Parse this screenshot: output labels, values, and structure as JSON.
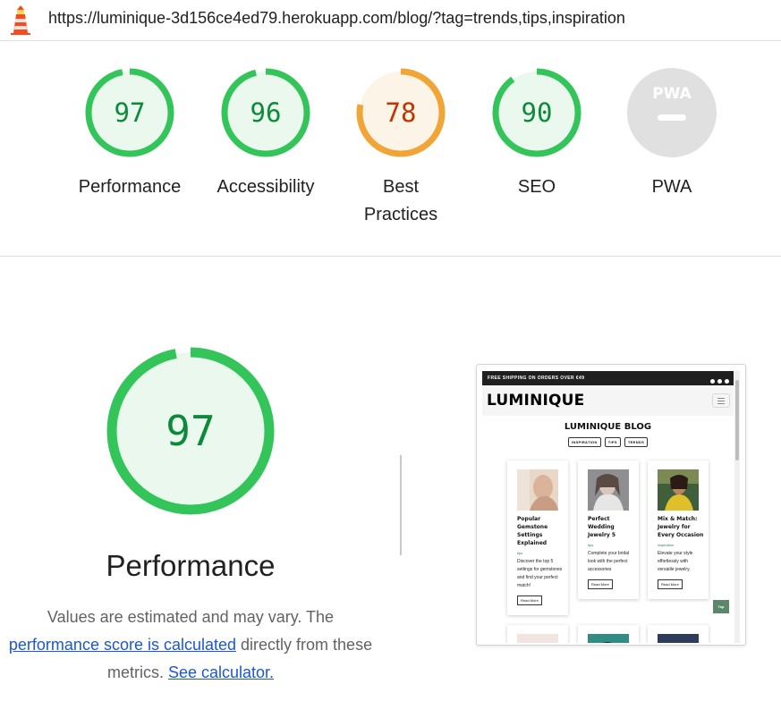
{
  "address_bar": {
    "url": "https://luminique-3d156ce4ed79.herokuapp.com/blog/?tag=trends,tips,inspiration"
  },
  "gauges": [
    {
      "label": "Performance",
      "score": "97",
      "value": 97,
      "status": "pass"
    },
    {
      "label": "Accessibility",
      "score": "96",
      "value": 96,
      "status": "pass"
    },
    {
      "label": "Best Practices",
      "score": "78",
      "value": 78,
      "status": "average"
    },
    {
      "label": "SEO",
      "score": "90",
      "value": 90,
      "status": "pass"
    },
    {
      "label": "PWA",
      "badge": "PWA",
      "status": "na"
    }
  ],
  "performance": {
    "score": "97",
    "value": 97,
    "title": "Performance",
    "desc_start": "Values are estimated and may vary. The ",
    "link_score": "performance score is calculated",
    "desc_mid": " directly from these metrics. ",
    "link_calc": "See calculator."
  },
  "colors": {
    "pass_stroke": "#33c55a",
    "pass_fill": "#eaf8ee",
    "pass_text": "#0c8a3a",
    "average_stroke": "#f2a537",
    "average_fill": "#fdf4e8",
    "average_text": "#c33300",
    "na_fill": "#e0e0e0"
  },
  "screenshot": {
    "shipping_text": "FREE SHIPPING ON ORDERS OVER €49",
    "logo": "LUMINIQUE",
    "blog_title": "LUMINIQUE BLOG",
    "tags": [
      "INSPIRATION",
      "TIPS",
      "TRENDS"
    ],
    "cards": [
      {
        "title": "Popular Gemstone Settings Explained",
        "category": "tips",
        "desc": "Discover the top 5 settings for gemstones and find your perfect match!",
        "button": "Read More"
      },
      {
        "title": "Perfect Wedding Jewelry 5",
        "category": "tips",
        "desc": "Complete your bridal look with the perfect accessories",
        "button": "Read More"
      },
      {
        "title": "Mix & Match: Jewelry for Every Occasion",
        "category": "inspiration",
        "desc": "Elevate your style effortlessly with versatile jewelry.",
        "button": "Read More"
      }
    ],
    "top_button": "Top"
  }
}
